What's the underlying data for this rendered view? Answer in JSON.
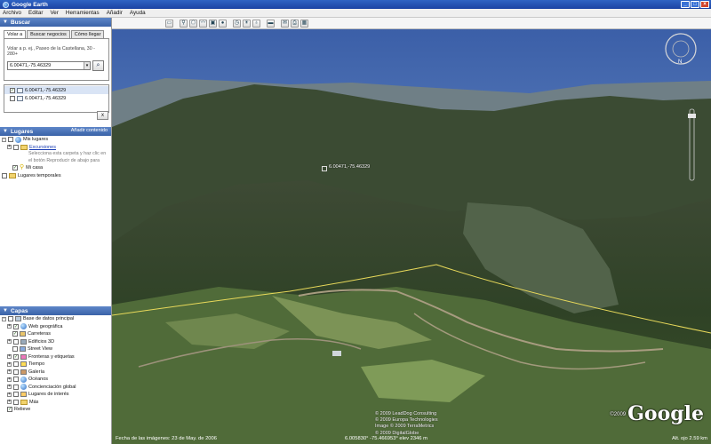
{
  "window": {
    "title": "Google Earth"
  },
  "menu": [
    "Archivo",
    "Editar",
    "Ver",
    "Herramientas",
    "Añadir",
    "Ayuda"
  ],
  "toolbar_icons": [
    "hide-sidebar-icon",
    "placemark-icon",
    "polygon-icon",
    "path-icon",
    "image-overlay-icon",
    "record-tour-icon",
    "historical-imagery-icon",
    "sun-icon",
    "planets-icon",
    "ruler-icon",
    "email-icon",
    "print-icon",
    "view-in-maps-icon"
  ],
  "search": {
    "title": "Buscar",
    "tabs": [
      "Volar a",
      "Buscar negocios",
      "Cómo llegar"
    ],
    "hint": "Volar a p. ej., Paseo de la Castellana, 30 - 280+",
    "value": "6.00471,-75.46329",
    "results": [
      "6.00471,-75.46329",
      "6.00471,-75.46329"
    ],
    "clear_label": "x"
  },
  "places": {
    "title": "Lugares",
    "add_content": "Añadir contenido",
    "my_places": "Mis lugares",
    "tours": "Excursiones",
    "tours_desc": [
      "Selecciona esta carpeta y haz clic en",
      "el botón Reproducir de abajo para"
    ],
    "my_home": "Mi casa",
    "temporary": "Lugares temporales"
  },
  "layers": {
    "title": "Capas",
    "items": [
      "Base de datos principal",
      "Web geográfica",
      "Carreteras",
      "Edificios 3D",
      "Street View",
      "Fronteras y etiquetas",
      "Tiempo",
      "Galería",
      "Océanos",
      "Concienciación global",
      "Lugares de interés",
      "Más",
      "Relieve"
    ]
  },
  "map": {
    "placemark": "6.00471,-75.46329",
    "copyright": [
      "© 2009 LeadDog Consulting",
      "© 2009 Europa Technologies",
      "Image © 2009 TerraMetrics",
      "© 2009 DigitalGlobe"
    ],
    "logo_year": "©2009",
    "logo": "Google",
    "image_date": "Fecha de las imágenes: 23 de May. de 2006",
    "coords": "6.005830°  -75.466953°  elev  2346 m",
    "eye_alt": "Alt. ojo    2.59 km"
  }
}
